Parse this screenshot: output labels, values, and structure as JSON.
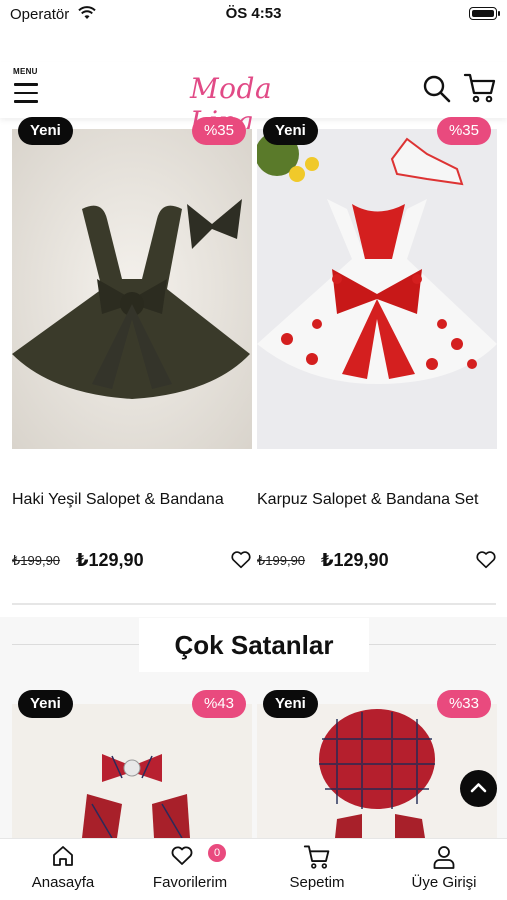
{
  "status_bar": {
    "carrier": "Operatör",
    "time": "ÖS 4:53"
  },
  "header": {
    "menu_label": "MENU",
    "logo_text": "Moda Lina"
  },
  "products_top": [
    {
      "badge": "Yeni",
      "discount": "%35",
      "name": "Haki Yeşil Salopet & Bandana",
      "old_price": "₺199,90",
      "price": "₺129,90"
    },
    {
      "badge": "Yeni",
      "discount": "%35",
      "name": "Karpuz Salopet & Bandana Set",
      "old_price": "₺199,90",
      "price": "₺129,90"
    }
  ],
  "best_sellers": {
    "title": "Çok Satanlar",
    "products": [
      {
        "badge": "Yeni",
        "discount": "%43"
      },
      {
        "badge": "Yeni",
        "discount": "%33"
      }
    ]
  },
  "tabbar": {
    "home": "Anasayfa",
    "favorites": "Favorilerim",
    "favorites_count": "0",
    "cart": "Sepetim",
    "login": "Üye Girişi"
  },
  "colors": {
    "accent": "#e94a7e",
    "badge_dark": "#0b0b0b",
    "logo_pink": "#e14a86"
  }
}
